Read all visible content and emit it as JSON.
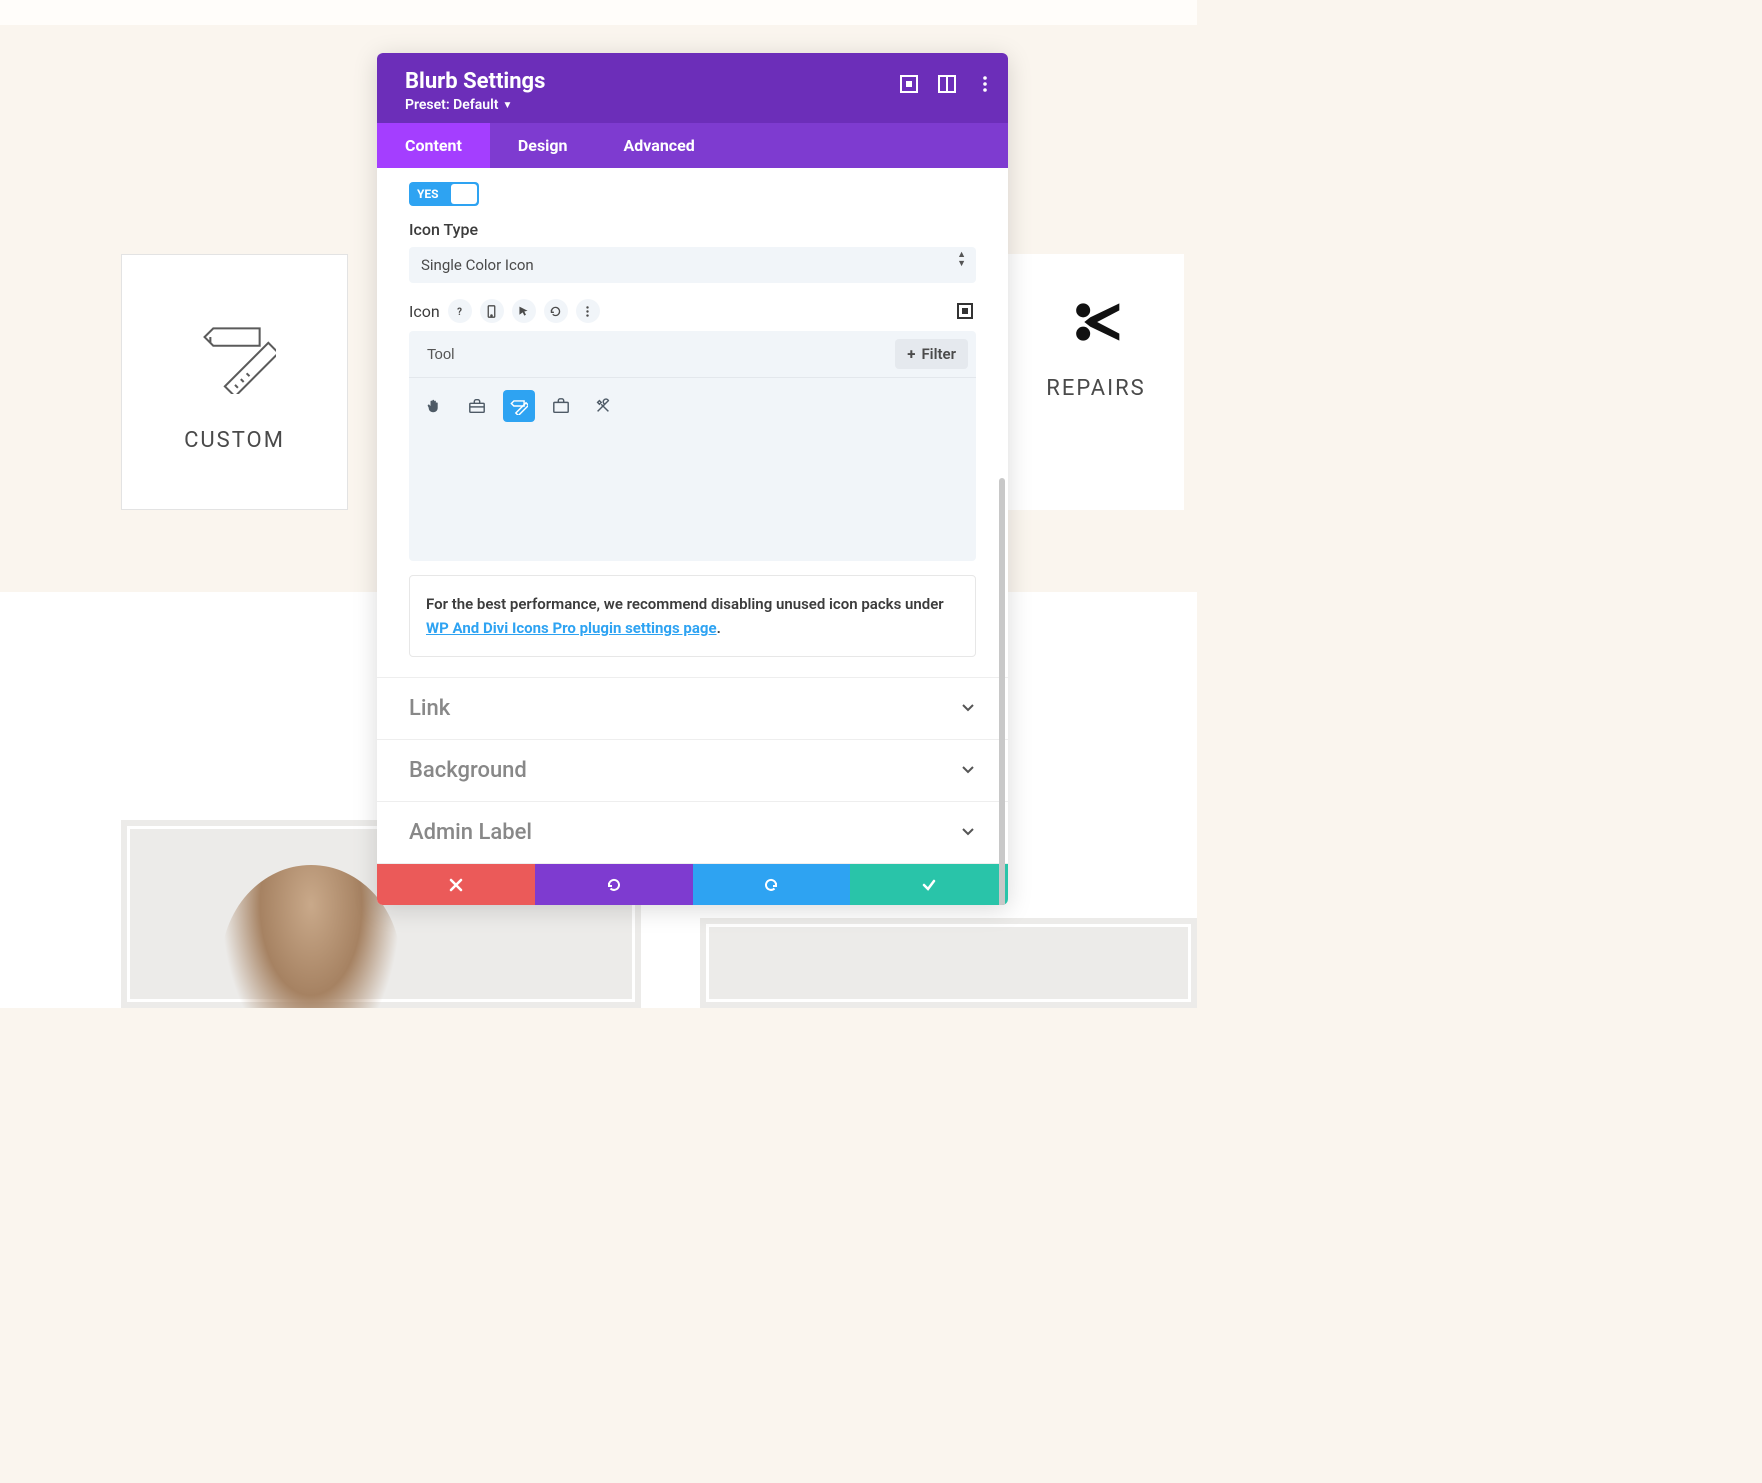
{
  "bg": {
    "left_card_label": "CUSTOM",
    "right_card_label": "REPAIRS"
  },
  "modal": {
    "title": "Blurb Settings",
    "preset": "Preset: Default",
    "tabs": {
      "content": "Content",
      "design": "Design",
      "advanced": "Advanced"
    },
    "toggle_label": "YES",
    "icon_type_label": "Icon Type",
    "icon_type_value": "Single Color Icon",
    "icon_label": "Icon",
    "search_value": "Tool",
    "filter_label": "Filter",
    "notice_prefix": "For the best performance, we recommend disabling unused icon packs under ",
    "notice_link": "WP And Divi Icons Pro plugin settings page",
    "notice_suffix": ".",
    "accordion": {
      "link": "Link",
      "background": "Background",
      "admin": "Admin Label"
    }
  }
}
